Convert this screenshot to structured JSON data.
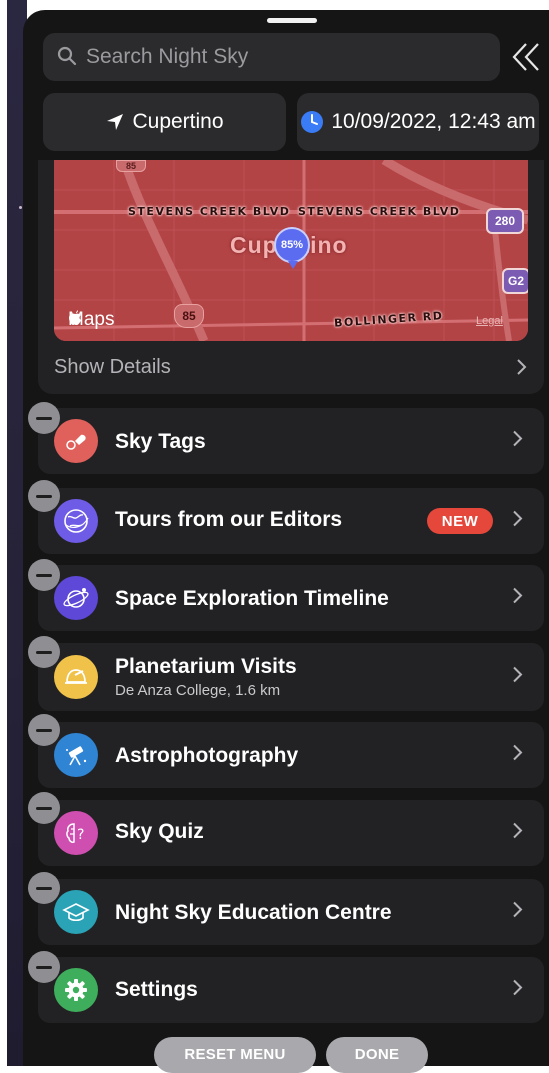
{
  "search": {
    "placeholder": "Search Night Sky"
  },
  "location": {
    "label": "Cupertino"
  },
  "datetime": {
    "label": "10/09/2022, 12:43 am"
  },
  "map": {
    "road_labels": [
      "STEVENS CREEK BLVD",
      "STEVENS CREEK BLVD",
      "BOLLINGER RD"
    ],
    "city_label": "Cupertino",
    "pin_value": "85%",
    "shields": [
      "85",
      "85",
      "280",
      "G2"
    ],
    "attribution": "Maps",
    "legal": "Legal"
  },
  "details": {
    "label": "Show Details"
  },
  "menu": [
    {
      "title": "Sky Tags",
      "subtitle": "",
      "icon": "sky-tags-icon",
      "color": "#e0605c"
    },
    {
      "title": "Tours from our Editors",
      "subtitle": "",
      "icon": "globe-icon",
      "color": "#6f5ce6",
      "badge": "NEW"
    },
    {
      "title": "Space Exploration Timeline",
      "subtitle": "",
      "icon": "orbit-globe-icon",
      "color": "#5d48d8"
    },
    {
      "title": "Planetarium Visits",
      "subtitle": "De Anza College, 1.6 km",
      "icon": "planetarium-icon",
      "color": "#f0c24a"
    },
    {
      "title": "Astrophotography",
      "subtitle": "",
      "icon": "telescope-icon",
      "color": "#2f84d4"
    },
    {
      "title": "Sky Quiz",
      "subtitle": "",
      "icon": "brain-question-icon",
      "color": "#cf4fb0"
    },
    {
      "title": "Night Sky Education Centre",
      "subtitle": "",
      "icon": "graduation-cap-icon",
      "color": "#29a3b5"
    },
    {
      "title": "Settings",
      "subtitle": "",
      "icon": "gear-icon",
      "color": "#3fae5c"
    }
  ],
  "footer": {
    "reset_label": "RESET MENU",
    "done_label": "DONE"
  },
  "colors": {
    "panel": "#151515",
    "row": "#222224",
    "accent_blue": "#3a7cf5",
    "map_red": "#b34446",
    "new_badge": "#e5473a"
  }
}
